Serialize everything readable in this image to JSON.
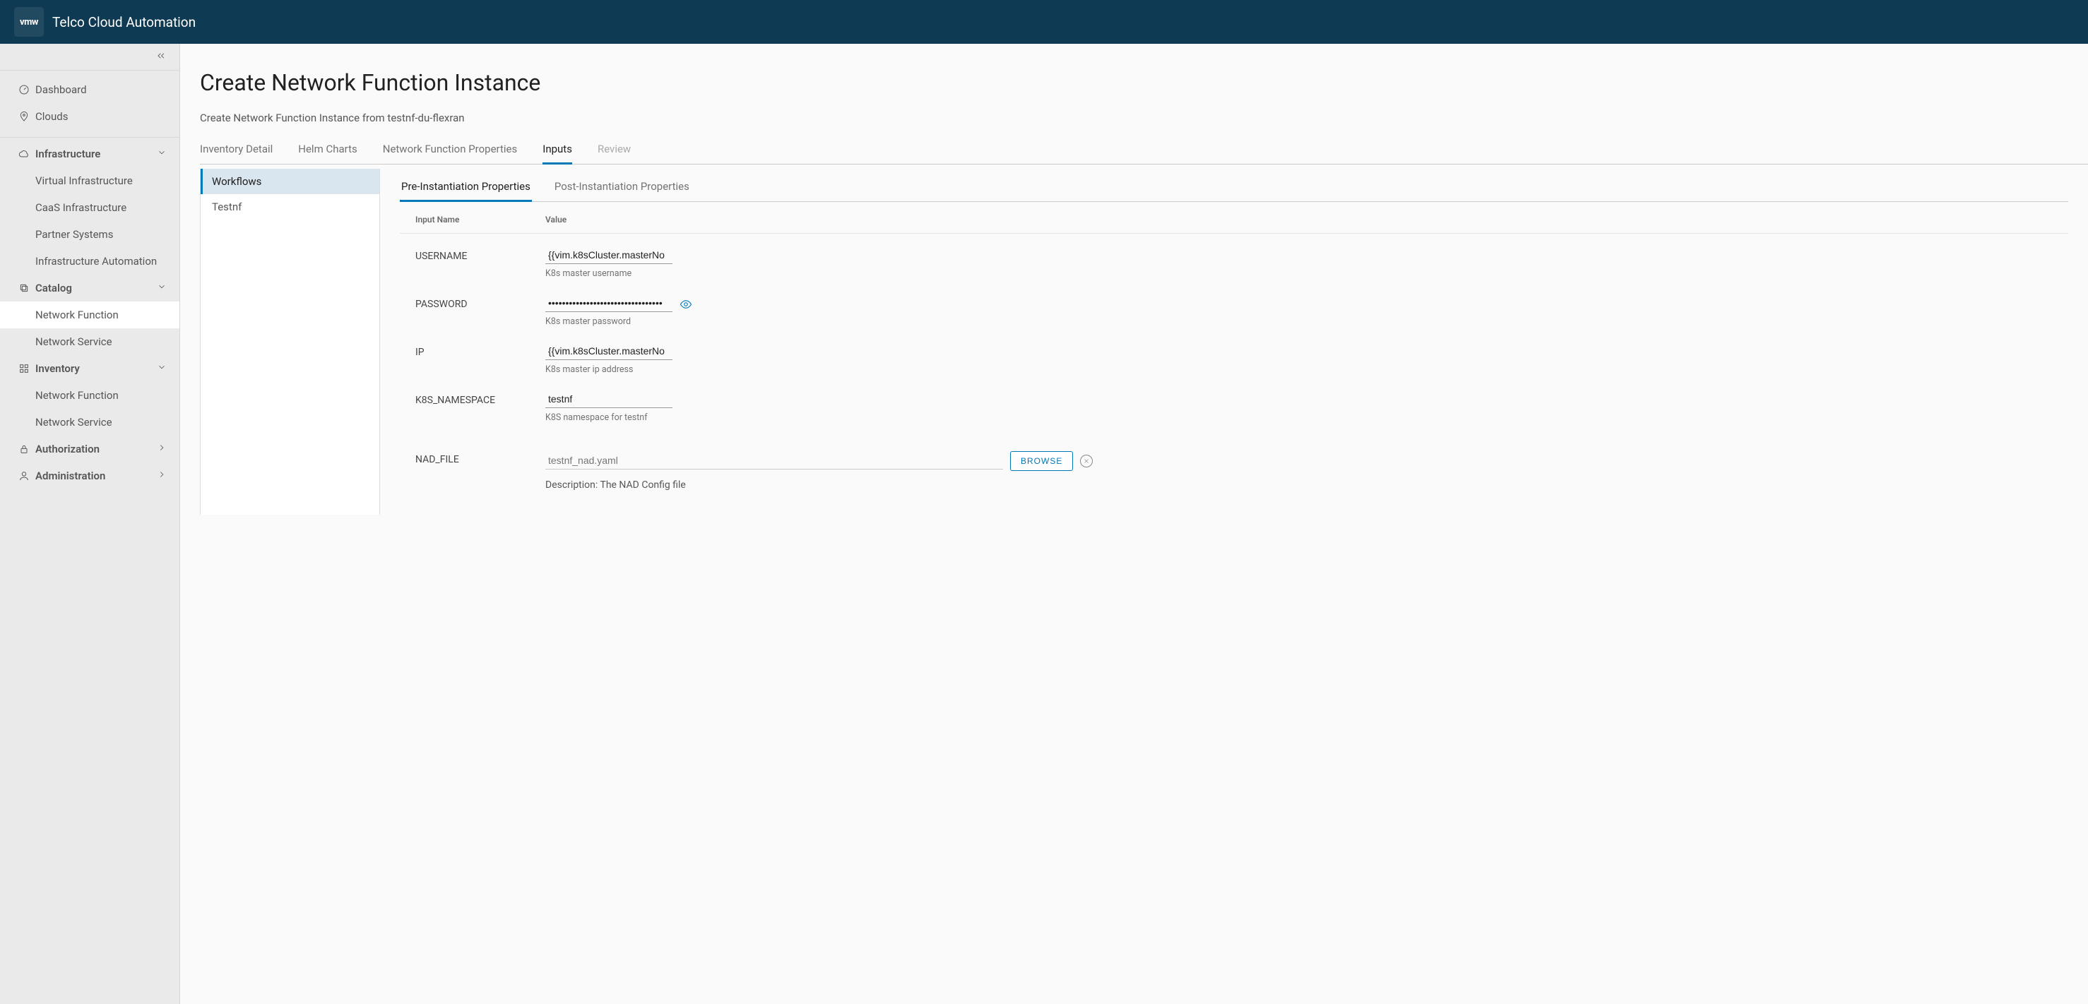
{
  "header": {
    "logo_text": "vmw",
    "title": "Telco Cloud Automation"
  },
  "sidebar": {
    "top": [
      {
        "label": "Dashboard"
      },
      {
        "label": "Clouds"
      }
    ],
    "infra": {
      "label": "Infrastructure",
      "items": [
        "Virtual Infrastructure",
        "CaaS Infrastructure",
        "Partner Systems",
        "Infrastructure Automation"
      ]
    },
    "catalog": {
      "label": "Catalog",
      "items": [
        "Network Function",
        "Network Service"
      ]
    },
    "inventory": {
      "label": "Inventory",
      "items": [
        "Network Function",
        "Network Service"
      ]
    },
    "authorization": {
      "label": "Authorization"
    },
    "administration": {
      "label": "Administration"
    }
  },
  "page": {
    "title": "Create Network Function Instance",
    "subtitle": "Create Network Function Instance from testnf-du-flexran"
  },
  "steps": [
    "Inventory Detail",
    "Helm Charts",
    "Network Function Properties",
    "Inputs",
    "Review"
  ],
  "subnav": [
    "Workflows",
    "Testnf"
  ],
  "inner_tabs": [
    "Pre-Instantiation Properties",
    "Post-Instantiation Properties"
  ],
  "table": {
    "head_name": "Input Name",
    "head_value": "Value"
  },
  "fields": {
    "username": {
      "label": "USERNAME",
      "value": "{{vim.k8sCluster.masterNo",
      "helper": "K8s master username"
    },
    "password": {
      "label": "PASSWORD",
      "value": "•••••••••••••••••••••••••••••••••",
      "helper": "K8s master password"
    },
    "ip": {
      "label": "IP",
      "value": "{{vim.k8sCluster.masterNo",
      "helper": "K8s master ip address"
    },
    "namespace": {
      "label": "K8S_NAMESPACE",
      "value": "testnf",
      "helper": "K8S namespace for testnf"
    },
    "nad": {
      "label": "NAD_FILE",
      "placeholder": "testnf_nad.yaml",
      "helper": "Description: The NAD Config file",
      "browse": "BROWSE"
    }
  }
}
